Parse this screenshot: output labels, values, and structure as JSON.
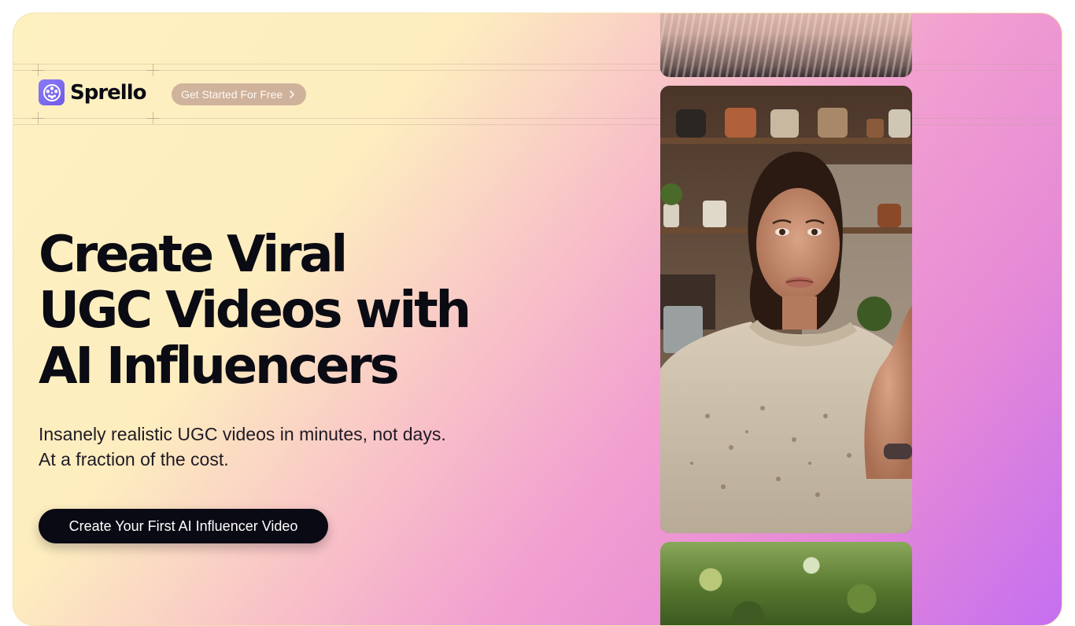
{
  "brand": {
    "name": "Sprello",
    "logo_icon": "film-reel-icon",
    "accent": "#7b6cf2"
  },
  "header": {
    "pill_label": "Get Started For Free",
    "pill_icon": "chevron-right-icon"
  },
  "hero": {
    "headline_lines": [
      "Create Viral",
      "UGC Videos with",
      "AI Influencers"
    ],
    "subtitle_lines": [
      "Insanely realistic UGC videos in minutes, not days.",
      "At a fraction of the cost."
    ],
    "cta_label": "Create Your First AI Influencer Video"
  },
  "videos": [
    {
      "name": "video-thumbnail-top",
      "subject": "blonde hair"
    },
    {
      "name": "video-thumbnail-main",
      "subject": "woman in cream sweater in kitchen"
    },
    {
      "name": "video-thumbnail-bottom",
      "subject": "green foliage"
    }
  ],
  "colors": {
    "gradient_start": "#fef1c0",
    "gradient_mid": "#f2a0d0",
    "gradient_end": "#c56ff0",
    "cta_bg": "#0a0a14"
  }
}
